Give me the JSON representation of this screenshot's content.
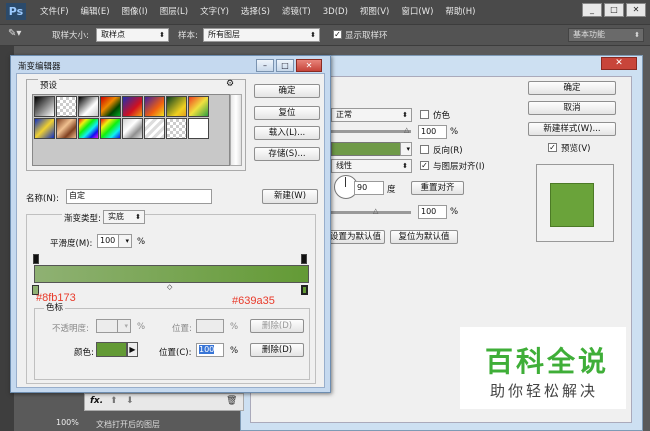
{
  "app": {
    "logo": "Ps",
    "menus": [
      "文件(F)",
      "编辑(E)",
      "图像(I)",
      "图层(L)",
      "文字(Y)",
      "选择(S)",
      "滤镜(T)",
      "3D(D)",
      "视图(V)",
      "窗口(W)",
      "帮助(H)"
    ],
    "window_controls": [
      "_",
      "□",
      "✕"
    ]
  },
  "options_bar": {
    "sample_size_label": "取样大小:",
    "sample_size_value": "取样点",
    "sample_label": "样本:",
    "sample_value": "所有图层",
    "show_ring_label": "显示取样环",
    "show_ring_checked": "✓",
    "workspace": "基本功能"
  },
  "layer_style_dialog": {
    "blend_mode": "正常",
    "dither_label": "仿色",
    "opacity_value": "100",
    "percent": "%",
    "reverse_label": "反向(R)",
    "style_value": "线性",
    "align_layer_label": "与图层对齐(I)",
    "align_layer_checked": "✓",
    "angle_value": "90",
    "degree_label": "度",
    "reset_align_button": "重置对齐",
    "scale_value": "100",
    "set_default_button": "设置为默认值",
    "reset_default_button": "复位为默认值",
    "ok_button": "确定",
    "cancel_button": "取消",
    "new_style_button": "新建样式(W)...",
    "preview_label": "预览(V)",
    "preview_checked": "✓",
    "fx_label": "fx.",
    "zoom": "100%",
    "bottom_text": "文档打开后的图层"
  },
  "gradient_editor": {
    "title": "渐变编辑器",
    "presets_label": "预设",
    "gear_icon": "⚙",
    "buttons": {
      "ok": "确定",
      "reset": "复位",
      "load": "载入(L)...",
      "save": "存储(S)..."
    },
    "name_label": "名称(N):",
    "name_value": "自定",
    "new_button": "新建(W)",
    "type_label": "渐变类型:",
    "type_value": "实底",
    "smoothness_label": "平滑度(M):",
    "smoothness_value": "100",
    "percent": "%",
    "start_color": "#8fb173",
    "end_color": "#639a35",
    "start_hex": "#8fb173",
    "end_hex": "#639a35",
    "stops_group": "色标",
    "opacity_label": "不透明度:",
    "opacity_value": "",
    "location_label": "位置:",
    "location_value": "",
    "delete_button_disabled": "删除(D)",
    "color_label": "颜色:",
    "color_swatch": "#639a35",
    "color_location_label": "位置(C):",
    "color_location_value": "100",
    "delete_button": "删除(D)"
  },
  "watermark": {
    "title": "百科全说",
    "subtitle": "助你轻松解决"
  }
}
